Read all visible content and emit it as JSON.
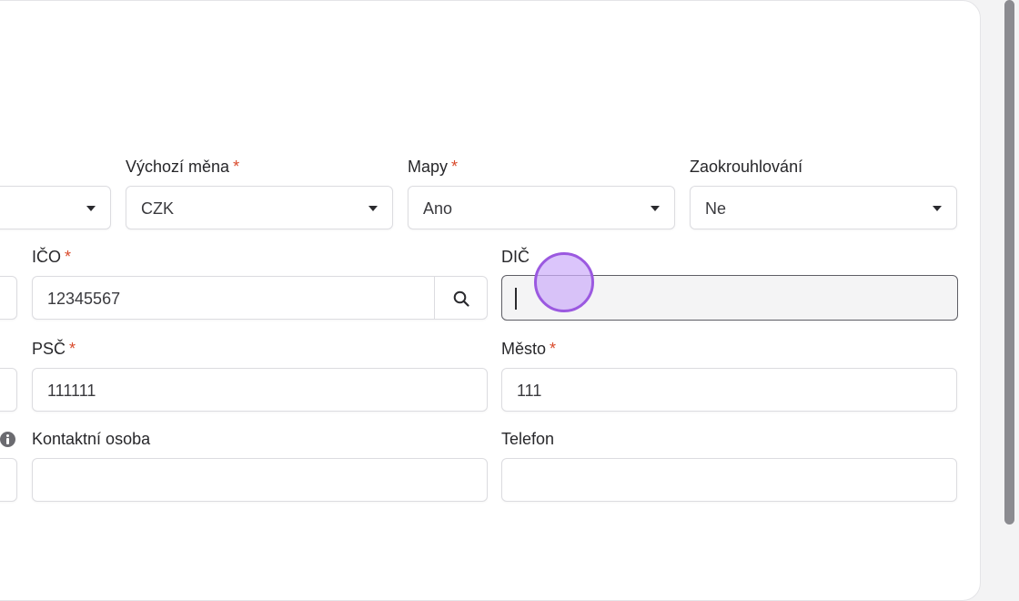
{
  "row1": {
    "currency": {
      "label": "Výchozí měna",
      "value": "CZK"
    },
    "maps": {
      "label": "Mapy",
      "value": "Ano"
    },
    "rounding": {
      "label": "Zaokrouhlování",
      "value": "Ne"
    }
  },
  "row2": {
    "ico": {
      "label": "IČO",
      "value": "12345567"
    },
    "dic": {
      "label": "DIČ",
      "value": ""
    }
  },
  "row3": {
    "psc": {
      "label": "PSČ",
      "value": "111111"
    },
    "city": {
      "label": "Město",
      "value": "111"
    }
  },
  "row4": {
    "contact": {
      "label": "Kontaktní osoba",
      "value": ""
    },
    "phone": {
      "label": "Telefon",
      "value": ""
    }
  },
  "required_mark": "*",
  "colors": {
    "required": "#d94a2b",
    "focus_border": "#5f5f66",
    "click_indicator": "#9b59e0"
  },
  "icons": {
    "dropdown": "chevron-down-icon",
    "search": "search-icon",
    "info": "info-icon"
  }
}
